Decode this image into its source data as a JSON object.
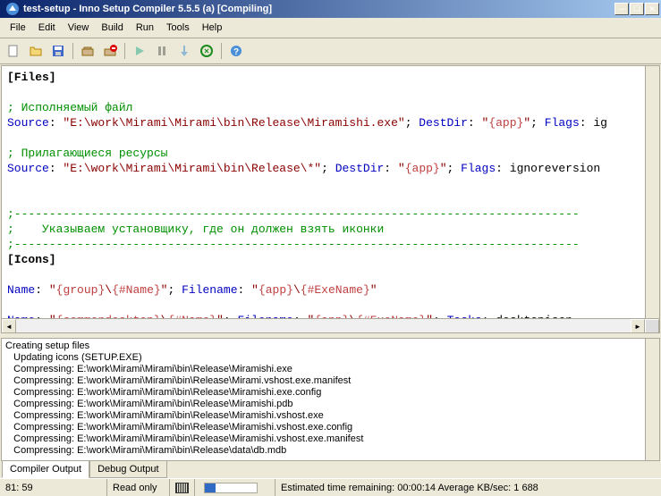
{
  "titlebar": {
    "text": "test-setup - Inno Setup Compiler 5.5.5 (a)  [Compiling]"
  },
  "menu": [
    "File",
    "Edit",
    "View",
    "Build",
    "Run",
    "Tools",
    "Help"
  ],
  "code": {
    "line1": "[Files]",
    "line2_comment": "; Исполняемый файл",
    "line3_dir1": "Source",
    "line3_str1": "\"E:\\work\\Mirami\\Mirami\\bin\\Release\\Miramishi.exe\"",
    "line3_dir2": "DestDir",
    "line3_str2a": "\"",
    "line3_con": "{app}",
    "line3_str2b": "\"",
    "line3_dir3": "Flags",
    "line3_tail": ": ig",
    "line4_comment": "; Прилагающиеся ресурсы",
    "line5_dir1": "Source",
    "line5_str1": "\"E:\\work\\Mirami\\Mirami\\bin\\Release\\*\"",
    "line5_dir2": "DestDir",
    "line5_str2a": "\"",
    "line5_con": "{app}",
    "line5_str2b": "\"",
    "line5_dir3": "Flags",
    "line5_tail": ": ignoreversion ",
    "dash": ";---------------------------------------------------------------------------------",
    "line6_comment": ";    Указываем установщику, где он должен взять иконки",
    "line7": "[Icons]",
    "line8_dir1": "Name",
    "line8_str1a": "\"",
    "line8_con1": "{group}",
    "line8_str1b": "\\",
    "line8_con2": "{#Name}",
    "line8_str1c": "\"",
    "line8_dir2": "Filename",
    "line8_str2a": "\"",
    "line8_con3": "{app}",
    "line8_str2b": "\\",
    "line8_con4": "{#ExeName}",
    "line8_str2c": "\"",
    "line9_dir1": "Name",
    "line9_str1a": "\"",
    "line9_con1": "{commondesktop}",
    "line9_str1b": "\\",
    "line9_con2": "{#Name}",
    "line9_str1c": "\"",
    "line9_dir2": "Filename",
    "line9_str2a": "\"",
    "line9_con3": "{app}",
    "line9_str2b": "\\",
    "line9_con4": "{#ExeName}",
    "line9_str2c": "\"",
    "line9_dir3": "Tasks",
    "line9_tail": ": desktopicon"
  },
  "output": {
    "lines": [
      "Creating setup files",
      "   Updating icons (SETUP.EXE)",
      "   Compressing: E:\\work\\Mirami\\Mirami\\bin\\Release\\Miramishi.exe",
      "   Compressing: E:\\work\\Mirami\\Mirami\\bin\\Release\\Mirami.vshost.exe.manifest",
      "   Compressing: E:\\work\\Mirami\\Mirami\\bin\\Release\\Miramishi.exe.config",
      "   Compressing: E:\\work\\Mirami\\Mirami\\bin\\Release\\Miramishi.pdb",
      "   Compressing: E:\\work\\Mirami\\Mirami\\bin\\Release\\Miramishi.vshost.exe",
      "   Compressing: E:\\work\\Mirami\\Mirami\\bin\\Release\\Miramishi.vshost.exe.config",
      "   Compressing: E:\\work\\Mirami\\Mirami\\bin\\Release\\Miramishi.vshost.exe.manifest",
      "   Compressing: E:\\work\\Mirami\\Mirami\\bin\\Release\\data\\db.mdb"
    ]
  },
  "tabs": {
    "compiler": "Compiler Output",
    "debug": "Debug Output"
  },
  "status": {
    "cursor": "   81: 59",
    "readonly": "Read only",
    "time": "Estimated time remaining: 00:00:14   Average KB/sec: 1 688"
  }
}
